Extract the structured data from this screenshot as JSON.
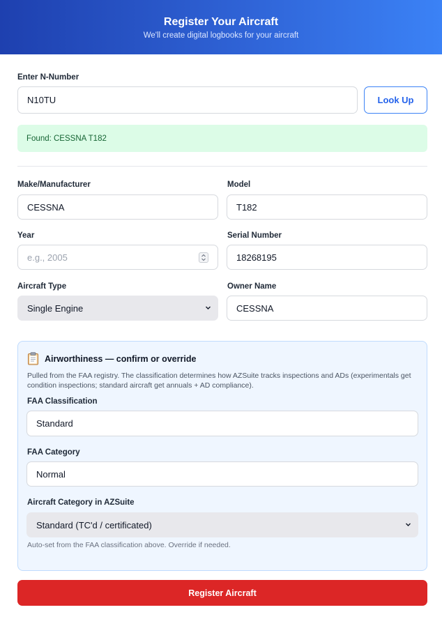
{
  "header": {
    "title": "Register Your Aircraft",
    "subtitle": "We'll create digital logbooks for your aircraft"
  },
  "lookup": {
    "label": "Enter N-Number",
    "value": "N10TU",
    "button_label": "Look Up",
    "found_message": "Found: CESSNA T182"
  },
  "details": {
    "make": {
      "label": "Make/Manufacturer",
      "value": "CESSNA"
    },
    "model": {
      "label": "Model",
      "value": "T182"
    },
    "year": {
      "label": "Year",
      "value": "",
      "placeholder": "e.g., 2005"
    },
    "serial": {
      "label": "Serial Number",
      "value": "18268195"
    },
    "aircraft_type": {
      "label": "Aircraft Type",
      "value": "Single Engine"
    },
    "owner": {
      "label": "Owner Name",
      "value": "CESSNA"
    }
  },
  "airworthiness": {
    "icon": "clipboard-icon",
    "title": "Airworthiness — confirm or override",
    "description": "Pulled from the FAA registry. The classification determines how AZSuite tracks inspections and ADs (experimentals get condition inspections; standard aircraft get annuals + AD compliance).",
    "faa_classification": {
      "label": "FAA Classification",
      "value": "Standard"
    },
    "faa_category": {
      "label": "FAA Category",
      "value": "Normal"
    },
    "azsuite_category": {
      "label": "Aircraft Category in AZSuite",
      "value": "Standard (TC'd / certificated)"
    },
    "hint": "Auto-set from the FAA classification above. Override if needed."
  },
  "submit": {
    "label": "Register Aircraft"
  },
  "colors": {
    "header_gradient_start": "#1e40af",
    "header_gradient_end": "#3b82f6",
    "accent": "#2563eb",
    "success_bg": "#dcfce7",
    "success_text": "#166534",
    "panel_bg": "#eff6ff",
    "danger": "#dc2626"
  }
}
